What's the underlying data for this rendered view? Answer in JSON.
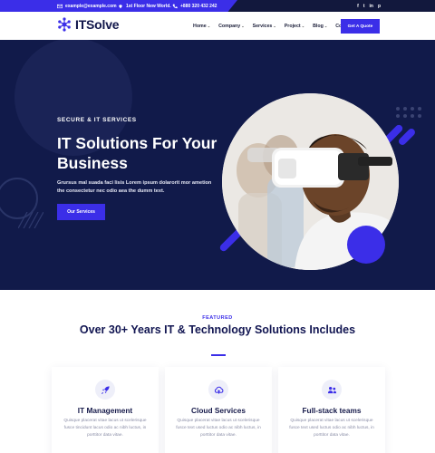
{
  "topbar": {
    "email": "example@example.com",
    "address": "1st Floor New World.",
    "phone": "+880 320 432 242",
    "social": [
      "f",
      "t",
      "in",
      "p"
    ]
  },
  "header": {
    "logo": "ITSolve",
    "nav": [
      "Home",
      "Company",
      "Services",
      "Project",
      "Blog",
      "Contact"
    ],
    "quote_button": "Get A Quote"
  },
  "hero": {
    "eyebrow": "SECURE & IT SERVICES",
    "title": "IT Solutions For Your Business",
    "description": "Grursus mal suada faci lisis Lorem ipsum dolarorit mor ametion the consectetur nec odio aea the dumm text.",
    "button": "Our Services"
  },
  "features": {
    "eyebrow": "FEATURED",
    "title": "Over 30+ Years IT & Technology Solutions Includes",
    "cards": [
      {
        "title": "IT Management",
        "icon": "rocket-icon",
        "desc": "Quisque placerat vitae lacus ut scelerisque fusce tincidunt lacus odio ac nibh luctus, in porttitor data vitae."
      },
      {
        "title": "Cloud Services",
        "icon": "cloud-icon",
        "desc": "Quisque placerat vitae lacus ut scelerisque fusce text used luctus odio ac nibh luctus, in porttitor data vitae."
      },
      {
        "title": "Full-stack teams",
        "icon": "team-icon",
        "desc": "Quisque placerat vitae lacus ut scelerisque fusce text used luctus odio ac nibh luctus, in porttitor data vitae."
      }
    ]
  },
  "colors": {
    "accent": "#3b2ee8",
    "hero_bg": "#111a4a",
    "topbar_bg": "#12183d"
  }
}
